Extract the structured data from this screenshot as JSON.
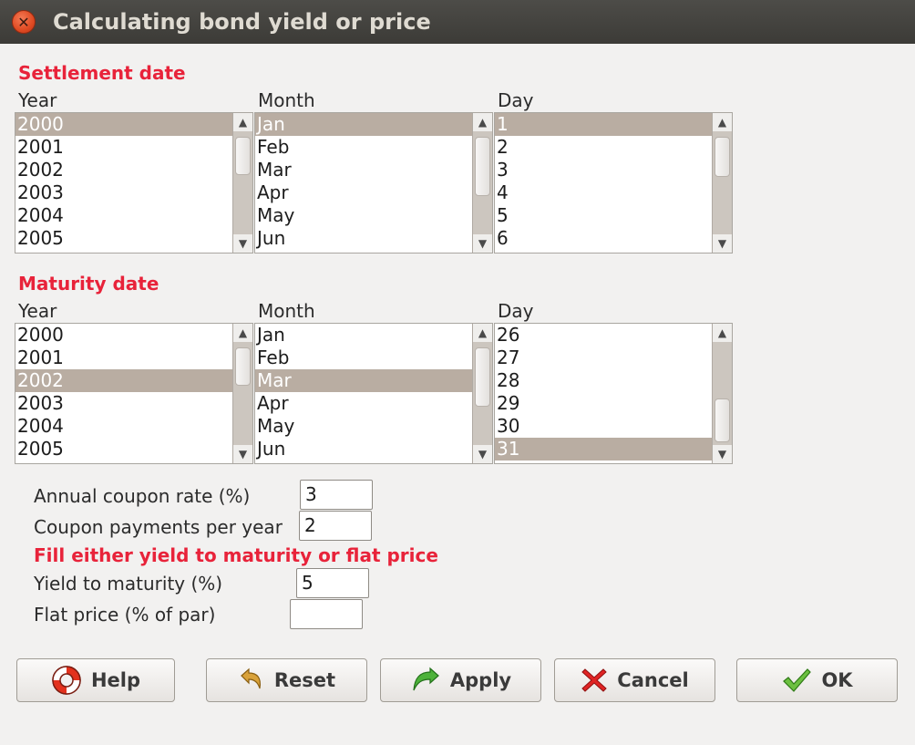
{
  "window": {
    "title": "Calculating bond yield or price"
  },
  "settlement": {
    "title": "Settlement date",
    "year_label": "Year",
    "month_label": "Month",
    "day_label": "Day",
    "years": [
      "2000",
      "2001",
      "2002",
      "2003",
      "2004",
      "2005"
    ],
    "months": [
      "Jan",
      "Feb",
      "Mar",
      "Apr",
      "May",
      "Jun"
    ],
    "days": [
      "1",
      "2",
      "3",
      "4",
      "5",
      "6"
    ],
    "selected_year": "2000",
    "selected_month": "Jan",
    "selected_day": "1"
  },
  "maturity": {
    "title": "Maturity date",
    "year_label": "Year",
    "month_label": "Month",
    "day_label": "Day",
    "years": [
      "2000",
      "2001",
      "2002",
      "2003",
      "2004",
      "2005"
    ],
    "months": [
      "Jan",
      "Feb",
      "Mar",
      "Apr",
      "May",
      "Jun"
    ],
    "days": [
      "26",
      "27",
      "28",
      "29",
      "30",
      "31"
    ],
    "selected_year": "2002",
    "selected_month": "Mar",
    "selected_day": "31"
  },
  "form": {
    "coupon_rate_label": "Annual coupon rate (%)",
    "coupon_rate_value": "3",
    "payments_label": "Coupon payments per year",
    "payments_value": "2",
    "instruction": "Fill either yield to maturity or flat price",
    "ytm_label": "Yield to maturity (%)",
    "ytm_value": "5",
    "flat_price_label": "Flat price (% of par)",
    "flat_price_value": ""
  },
  "buttons": {
    "help": "Help",
    "reset": "Reset",
    "apply": "Apply",
    "cancel": "Cancel",
    "ok": "OK"
  },
  "colors": {
    "accent_red": "#e8233a",
    "selection": "#b9ada2",
    "titlebar": "#3c3b37"
  }
}
